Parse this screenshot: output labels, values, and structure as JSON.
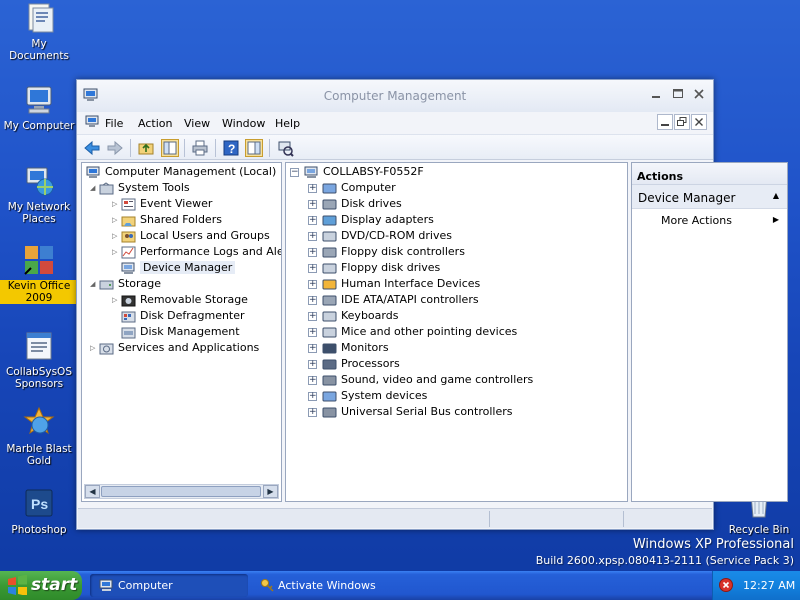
{
  "desktop": {
    "icons": [
      {
        "label": "My Documents"
      },
      {
        "label": "My Computer"
      },
      {
        "label": "My Network Places"
      },
      {
        "label": "Kevin Office 2009"
      },
      {
        "label": "CollabSysOS Sponsors"
      },
      {
        "label": "Marble Blast Gold"
      },
      {
        "label": "Photoshop"
      },
      {
        "label": "Recycle Bin"
      }
    ],
    "watermark": {
      "edition": "Windows XP Professional",
      "build": "Build 2600.xpsp.080413-2111 (Service Pack 3)"
    }
  },
  "window": {
    "title": "Computer Management",
    "menus": [
      "File",
      "Action",
      "View",
      "Window",
      "Help"
    ],
    "tree": {
      "root": "Computer Management (Local)",
      "system_tools": "System Tools",
      "event_viewer": "Event Viewer",
      "shared_folders": "Shared Folders",
      "local_users": "Local Users and Groups",
      "perf_logs": "Performance Logs and Alerts",
      "device_manager": "Device Manager",
      "storage": "Storage",
      "removable_storage": "Removable Storage",
      "disk_defrag": "Disk Defragmenter",
      "disk_mgmt": "Disk Management",
      "services_apps": "Services and Applications"
    },
    "devices": {
      "computer_name": "COLLABSY-F0552F",
      "categories": [
        "Computer",
        "Disk drives",
        "Display adapters",
        "DVD/CD-ROM drives",
        "Floppy disk controllers",
        "Floppy disk drives",
        "Human Interface Devices",
        "IDE ATA/ATAPI controllers",
        "Keyboards",
        "Mice and other pointing devices",
        "Monitors",
        "Processors",
        "Sound, video and game controllers",
        "System devices",
        "Universal Serial Bus controllers"
      ]
    },
    "actions": {
      "header": "Actions",
      "section": "Device Manager",
      "more_actions": "More Actions"
    }
  },
  "taskbar": {
    "start": "start",
    "tasks": [
      "Computer Management",
      "Activate Windows"
    ],
    "clock": "12:27 AM"
  }
}
